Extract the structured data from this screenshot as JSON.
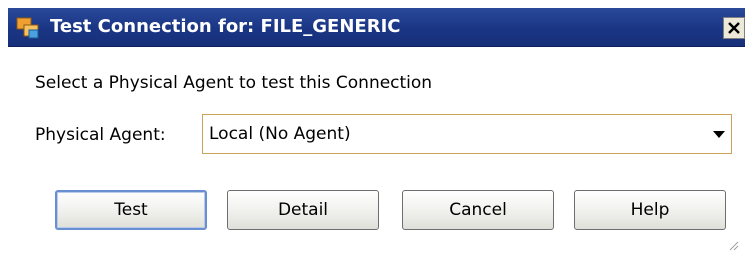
{
  "window": {
    "title": "Test Connection for: FILE_GENERIC",
    "icon": "connection-app-icon",
    "close_icon": "close-icon",
    "colors": {
      "titlebar": "#1a3584",
      "title_text": "#ffffff",
      "select_border": "#c9a35a",
      "default_button_border": "#6a8fd0"
    }
  },
  "prompt": "Select a Physical Agent to test this Connection",
  "physical_agent": {
    "label": "Physical Agent:",
    "selected": "Local (No Agent)"
  },
  "buttons": {
    "test": "Test",
    "detail": "Detail",
    "cancel": "Cancel",
    "help": "Help"
  }
}
